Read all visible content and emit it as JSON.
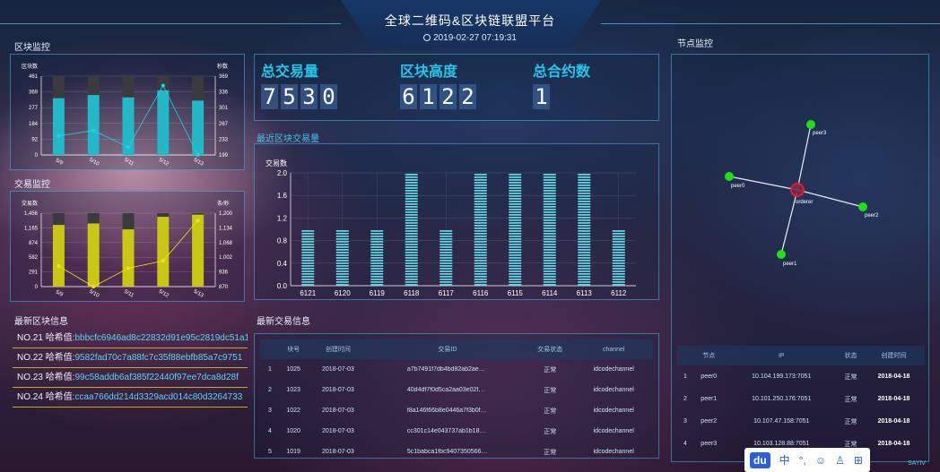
{
  "header": {
    "title": "全球二维码&区块链联盟平台",
    "datetime": "2019-02-27 07:19:31"
  },
  "sections": {
    "block_monitor": "区块监控",
    "tx_monitor": "交易监控",
    "latest_blocks": "最新区块信息",
    "recent_block_tx": "最近区块交易量",
    "latest_tx": "最新交易信息",
    "node_monitor": "节点监控"
  },
  "stats": [
    {
      "label": "总交易量",
      "digits": [
        "7",
        "5",
        "3",
        "0"
      ]
    },
    {
      "label": "区块高度",
      "digits": [
        "6",
        "1",
        "2",
        "2"
      ]
    },
    {
      "label": "总合约数",
      "digits": [
        "1"
      ]
    }
  ],
  "chart_data": [
    {
      "type": "bar",
      "name": "block-monitor-chart",
      "left_axis_label": "区块数",
      "right_axis_label": "秒数",
      "left_ticks": [
        "461",
        "369",
        "277",
        "184",
        "92",
        "0"
      ],
      "right_ticks": [
        "369",
        "336",
        "301",
        "267",
        "233",
        "199"
      ],
      "categories": [
        "5/9",
        "5/10",
        "5/11",
        "5/12",
        "5/13"
      ],
      "bar_values": [
        0.72,
        0.76,
        0.73,
        0.82,
        0.69
      ],
      "line_values": [
        0.24,
        0.31,
        0.1,
        0.88,
        0.0
      ],
      "bar_color": "#22b8c8",
      "line_color": "#22d4e0"
    },
    {
      "type": "bar",
      "name": "tx-monitor-chart",
      "left_axis_label": "交易数",
      "right_axis_label": "条/秒",
      "left_ticks": [
        "1,456",
        "1,165",
        "874",
        "582",
        "291",
        "0"
      ],
      "right_ticks": [
        "1,200",
        "1,134",
        "1,068",
        "1,002",
        "936",
        "870"
      ],
      "categories": [
        "5/9",
        "5/10",
        "5/11",
        "5/12",
        "5/13"
      ],
      "bar_values": [
        0.84,
        0.86,
        0.78,
        0.95,
        0.98
      ],
      "line_values": [
        0.28,
        0.0,
        0.25,
        0.35,
        0.9
      ],
      "bar_color": "#c8c814",
      "line_color": "#f2e316"
    },
    {
      "type": "bar",
      "name": "recent-block-tx-chart",
      "ylabel": "交易数",
      "yticks": [
        "2.0",
        "1.6",
        "1.2",
        "0.8",
        "0.4",
        "0.0"
      ],
      "ylim": [
        0,
        2
      ],
      "categories": [
        "6121",
        "6120",
        "6119",
        "6118",
        "6117",
        "6116",
        "6115",
        "6114",
        "6113",
        "6112"
      ],
      "values": [
        1,
        1,
        1,
        2,
        1,
        2,
        2,
        2,
        2,
        1
      ],
      "bar_color": "#5fd3df"
    }
  ],
  "latest_blocks": [
    {
      "no": "NO.21",
      "label": "哈希值:",
      "hash": "bbbcfc6946ad8c22832d91e95c2819dc51a1"
    },
    {
      "no": "NO.22",
      "label": "哈希值:",
      "hash": "9582fad70c7a88fc7c35f88ebfb85a7c9751"
    },
    {
      "no": "NO.23",
      "label": "哈希值:",
      "hash": "99c58addb6af385f22440f97ee7dca8d28f"
    },
    {
      "no": "NO.24",
      "label": "哈希值:",
      "hash": "ccaa766dd214d3329acd014c80d3264733"
    }
  ],
  "tx_table": {
    "headers": [
      "块号",
      "创建时间",
      "交易ID",
      "交易状态",
      "channel"
    ],
    "rows": [
      {
        "idx": "1",
        "block": "1025",
        "time": "2018-07-03",
        "txid": "a7b7491f7db4bd82ab2aea0bb5a...",
        "status": "正常",
        "channel": "idcodechannel"
      },
      {
        "idx": "2",
        "block": "1023",
        "time": "2018-07-03",
        "txid": "40d4df7f0d5ca2aa03e02f060a585...",
        "status": "正常",
        "channel": "idcodechannel"
      },
      {
        "idx": "3",
        "block": "1022",
        "time": "2018-07-03",
        "txid": "f8a146f66b8e0446a7f3b0f014e74d...",
        "status": "正常",
        "channel": "idcodechannel"
      },
      {
        "idx": "4",
        "block": "1020",
        "time": "2018-07-03",
        "txid": "cc301c14e043737ab1b186164d40...",
        "status": "正常",
        "channel": "idcodechannel"
      },
      {
        "idx": "5",
        "block": "1019",
        "time": "2018-07-03",
        "txid": "5c1babca1fbc9407350566ca24091...",
        "status": "正常",
        "channel": "idcodechannel"
      }
    ]
  },
  "node_table": {
    "headers": [
      "节点",
      "IP",
      "状态",
      "创建时间"
    ],
    "rows": [
      {
        "idx": "1",
        "node": "peer0",
        "ip": "10.104.199.173:7051",
        "status": "正常",
        "date": "2018-04-18"
      },
      {
        "idx": "2",
        "node": "peer1",
        "ip": "10.101.250.176:7051",
        "status": "正常",
        "date": "2018-04-18"
      },
      {
        "idx": "3",
        "node": "peer2",
        "ip": "10.107.47.158:7051",
        "status": "正常",
        "date": "2018-04-18"
      },
      {
        "idx": "4",
        "node": "peer3",
        "ip": "10.103.128.88:7051",
        "status": "正常",
        "date": "2018-04-18"
      }
    ]
  },
  "topology": {
    "center": "orderer",
    "peers": [
      "peer3",
      "peer0",
      "peer2",
      "peer1"
    ]
  },
  "toolbar": {
    "brand": "du",
    "items": [
      "中",
      "°,",
      "☺",
      "♙",
      "⊞"
    ]
  },
  "corner_text": "SAYIV"
}
